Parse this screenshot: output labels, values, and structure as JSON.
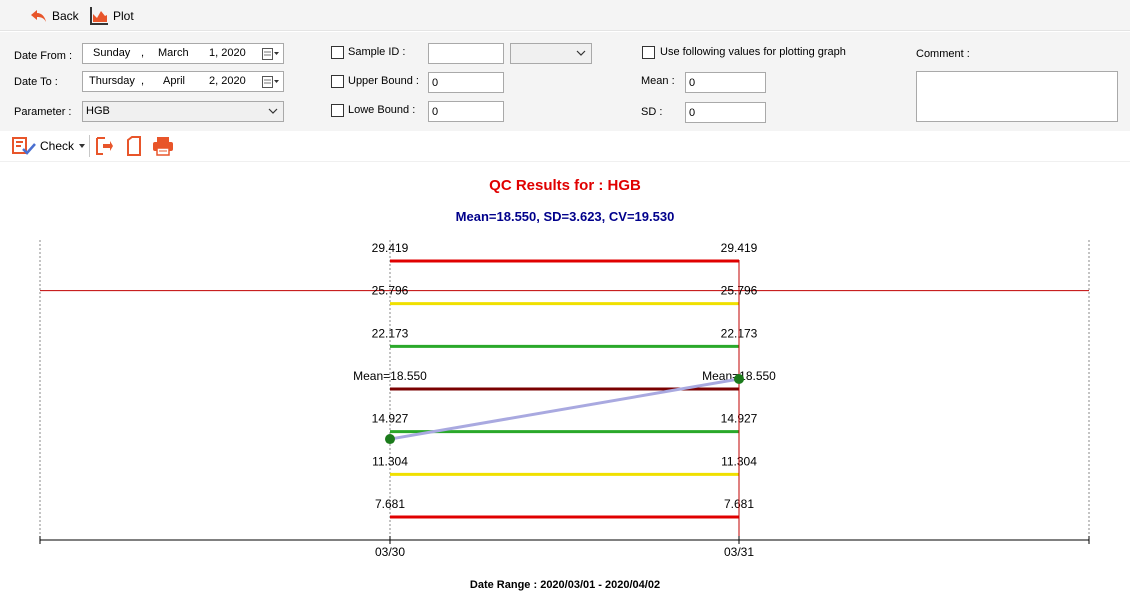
{
  "toolbar": {
    "back_label": "Back",
    "plot_label": "Plot",
    "check_label": "Check"
  },
  "form": {
    "date_from_label": "Date From :",
    "date_from": {
      "weekday": "Sunday",
      "comma1": ",",
      "month": "March",
      "day_year": "1, 2020"
    },
    "date_to_label": "Date To :",
    "date_to": {
      "weekday": "Thursday",
      "comma1": ",",
      "month": "April",
      "day_year": "2, 2020"
    },
    "parameter_label": "Parameter :",
    "parameter_value": "HGB",
    "sample_id_label": "Sample ID :",
    "sample_id_value": "",
    "sample_combo_value": "",
    "upper_bound_label": "Upper Bound :",
    "upper_bound_value": "0",
    "lower_bound_label": "Lowe Bound :",
    "lower_bound_value": "0",
    "use_values_label": "Use following values for plotting graph",
    "mean_label": "Mean :",
    "mean_value": "0",
    "sd_label": "SD :",
    "sd_value": "0",
    "comment_label": "Comment :",
    "comment_value": ""
  },
  "chart_data": {
    "type": "line",
    "title": "QC Results for : HGB",
    "subtitle": "Mean=18.550, SD=3.623, CV=19.530",
    "footer": "Date Range : 2020/03/01 - 2020/04/02",
    "categories": [
      "03/30",
      "03/31"
    ],
    "series": [
      {
        "values": [
          14.3,
          19.4
        ],
        "color": "#a9a9e0"
      }
    ],
    "reference_lines": [
      {
        "label": "29.419",
        "value": 29.419,
        "color": "#e00000"
      },
      {
        "label": "25.796",
        "value": 25.796,
        "color": "#f0e000"
      },
      {
        "label": "22.173",
        "value": 22.173,
        "color": "#2aa82a"
      },
      {
        "label": "Mean=18.550",
        "value": 18.55,
        "color": "#7a0000"
      },
      {
        "label": "14.927",
        "value": 14.927,
        "color": "#2aa82a"
      },
      {
        "label": "11.304",
        "value": 11.304,
        "color": "#f0e000"
      },
      {
        "label": "7.681",
        "value": 7.681,
        "color": "#e00000"
      }
    ],
    "upper_limit_line": 26.9,
    "title_color": "#e00000",
    "subtitle_color": "#00008b"
  }
}
